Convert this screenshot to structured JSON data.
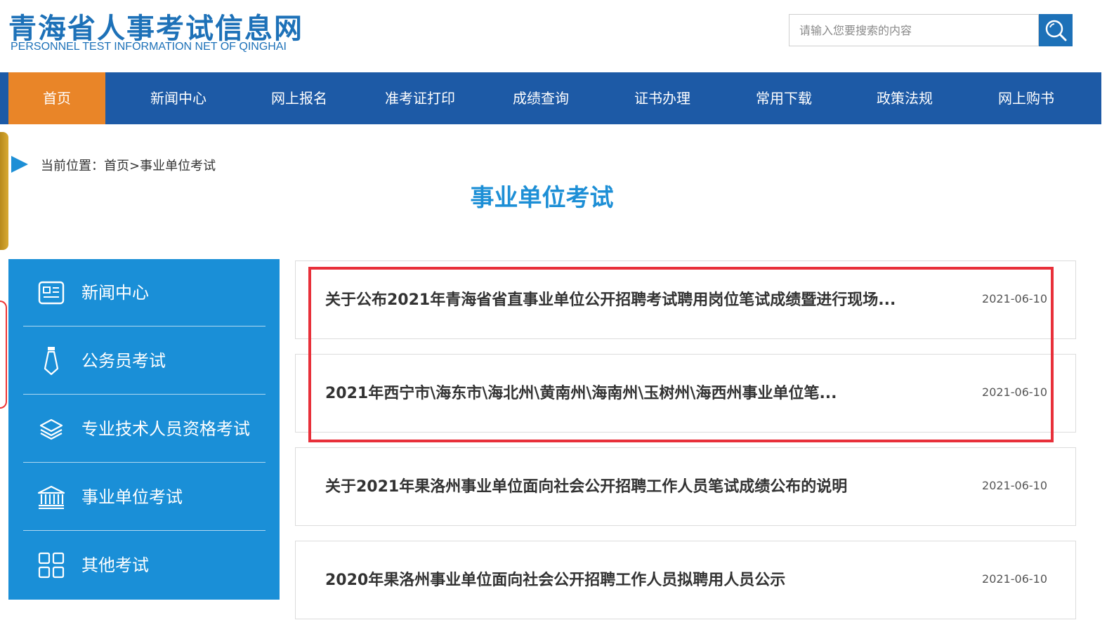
{
  "header": {
    "site_title": "青海省人事考试信息网",
    "site_subtitle": "PERSONNEL TEST INFORMATION NET OF QINGHAI",
    "search_placeholder": "请输入您要搜索的内容"
  },
  "nav": {
    "items": [
      {
        "label": "首页",
        "active": true
      },
      {
        "label": "新闻中心"
      },
      {
        "label": "网上报名"
      },
      {
        "label": "准考证打印"
      },
      {
        "label": "成绩查询"
      },
      {
        "label": "证书办理"
      },
      {
        "label": "常用下载"
      },
      {
        "label": "政策法规"
      },
      {
        "label": "网上购书"
      }
    ]
  },
  "breadcrumb": {
    "prefix": "当前位置：",
    "home": "首页",
    "separator": ">",
    "current": "事业单位考试"
  },
  "page_title": "事业单位考试",
  "sidebar": {
    "items": [
      {
        "label": "新闻中心",
        "icon": "news-icon"
      },
      {
        "label": "公务员考试",
        "icon": "tie-icon"
      },
      {
        "label": "专业技术人员资格考试",
        "icon": "layers-icon"
      },
      {
        "label": "事业单位考试",
        "icon": "institution-icon"
      },
      {
        "label": "其他考试",
        "icon": "grid-icon"
      }
    ]
  },
  "list": {
    "items": [
      {
        "title": "关于公布2021年青海省省直事业单位公开招聘考试聘用岗位笔试成绩暨进行现场...",
        "date": "2021-06-10"
      },
      {
        "title": "2021年西宁市\\海东市\\海北州\\黄南州\\海南州\\玉树州\\海西州事业单位笔...",
        "date": "2021-06-10"
      },
      {
        "title": "关于2021年果洛州事业单位面向社会公开招聘工作人员笔试成绩公布的说明",
        "date": "2021-06-10"
      },
      {
        "title": "2020年果洛州事业单位面向社会公开招聘工作人员拟聘用人员公示",
        "date": "2021-06-10"
      }
    ]
  },
  "colors": {
    "brand_blue": "#1d71b8",
    "nav_blue": "#1d5aa6",
    "nav_active": "#e98528",
    "sidebar_blue": "#1a8fd7",
    "highlight_red": "#e8303a"
  }
}
